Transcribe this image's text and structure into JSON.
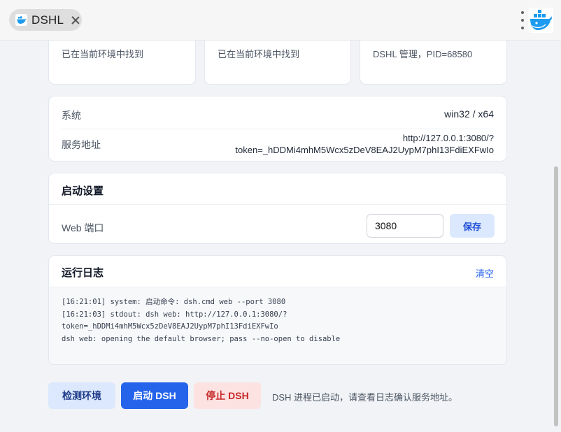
{
  "window": {
    "tab_title": "DSHL",
    "colors": {
      "accent": "#2563eb",
      "danger": "#c62828"
    }
  },
  "status_cards": [
    {
      "text": "已在当前环境中找到"
    },
    {
      "text": "已在当前环境中找到"
    },
    {
      "text": "DSHL 管理，PID=68580"
    }
  ],
  "info": {
    "system_label": "系统",
    "system_value": "win32 / x64",
    "address_label": "服务地址",
    "address_line1": "http://127.0.0.1:3080/?",
    "address_line2": "token=_hDDMi4mhM5Wcx5zDeV8EAJ2UypM7phI13FdiEXFwIo"
  },
  "startup": {
    "title": "启动设置",
    "port_label": "Web 端口",
    "port_value": "3080",
    "save_label": "保存"
  },
  "log": {
    "title": "运行日志",
    "clear_label": "清空",
    "lines": [
      "[16:21:01] system: 启动命令: dsh.cmd web --port 3080",
      "[16:21:03] stdout: dsh web: http://127.0.0.1:3080/?",
      "token=_hDDMi4mhM5Wcx5zDeV8EAJ2UypM7phI13FdiEXFwIo",
      "dsh web: opening the default browser; pass --no-open to disable"
    ]
  },
  "actions": {
    "detect_label": "检测环境",
    "start_label": "启动 DSH",
    "stop_label": "停止 DSH",
    "status_message": "DSH 进程已启动，请查看日志确认服务地址。"
  }
}
